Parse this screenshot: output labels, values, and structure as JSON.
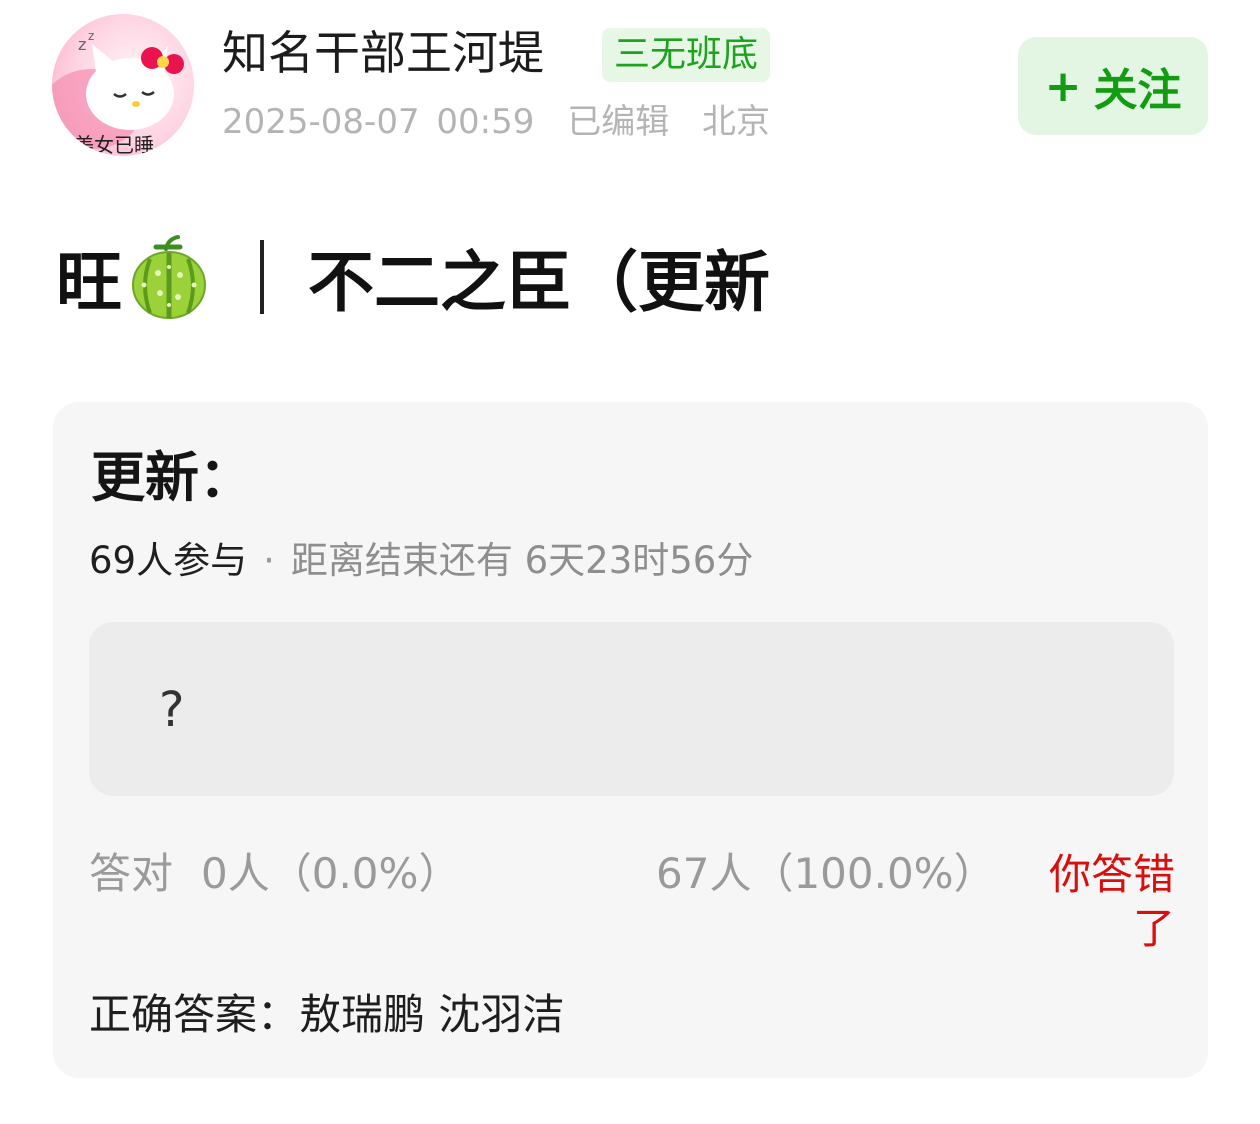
{
  "header": {
    "author_name": "知名干部王河堤",
    "author_tag": "三无班底",
    "avatar_caption": "美女已睡",
    "post_time": "2025-08-07 00:59",
    "edited_label": "已编辑",
    "location": "北京",
    "follow_plus": "+",
    "follow_label": "关注"
  },
  "post": {
    "title_prefix": "旺",
    "title_emoji": "melon-emoji",
    "title_main": "不二之臣（更新"
  },
  "vote": {
    "title": "更新：",
    "participants": "69人参与",
    "separator": "·",
    "remaining": "距离结束还有 6天23时56分",
    "option_text": "?",
    "correct_label": "答对",
    "correct_result": "0人（0.0%）",
    "wrong_result": "67人（100.0%）",
    "wrong_flag": "你答错了",
    "answer_label": "正确答案：",
    "answer_value": "敖瑞鹏 沈羽洁"
  },
  "colors": {
    "tag_green": "#1fa21f",
    "follow_bg": "#e3f6e3",
    "wrong_red": "#d90f0f",
    "card_bg": "#f6f6f6"
  }
}
